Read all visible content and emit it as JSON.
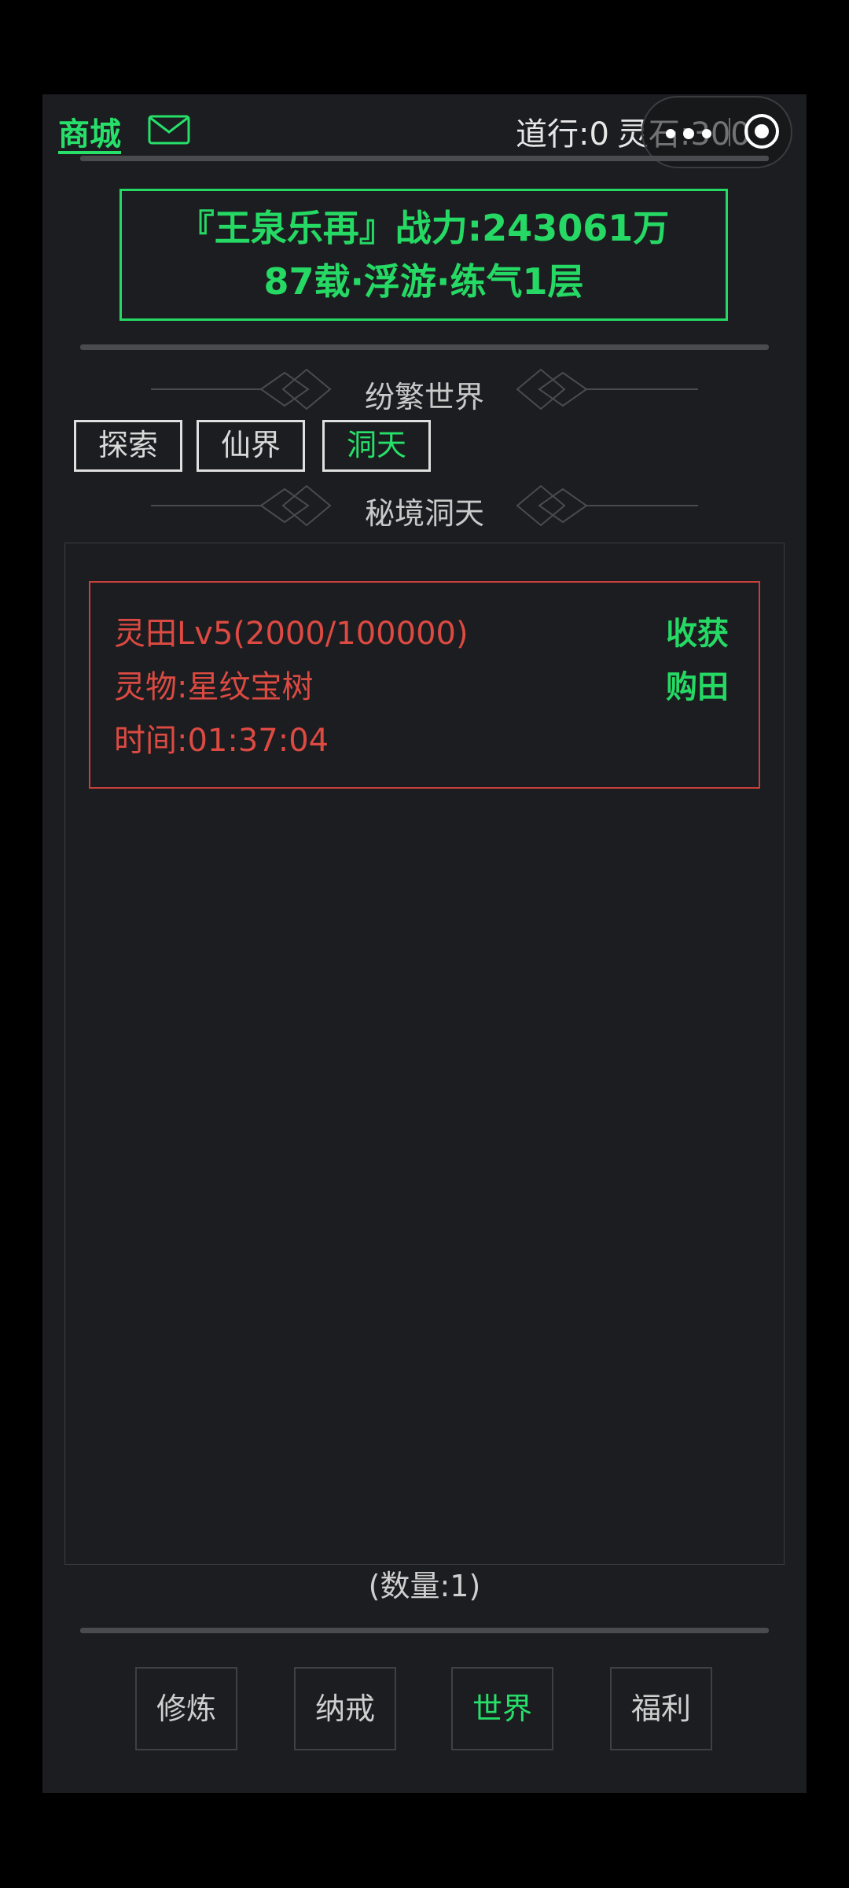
{
  "header": {
    "shop_label": "商城",
    "daoxing_label": "道行:0",
    "lingshi_label": "灵石:300"
  },
  "profile": {
    "line1": "『王泉乐再』战力:243061万",
    "line2": "87载·浮游·练气1层"
  },
  "sections": {
    "world_title": "纷繁世界",
    "realm_title": "秘境洞天"
  },
  "tabs": [
    {
      "label": "探索"
    },
    {
      "label": "仙界"
    },
    {
      "label": "洞天",
      "active": true
    }
  ],
  "field": {
    "level_text": "灵田Lv5(2000/100000)",
    "item_text": "灵物:星纹宝树",
    "time_text": "时间:01:37:04",
    "harvest_label": "收获",
    "buy_label": "购田"
  },
  "count_text": "(数量:1)",
  "nav": [
    {
      "label": "修炼"
    },
    {
      "label": "纳戒"
    },
    {
      "label": "世界",
      "active": true
    },
    {
      "label": "福利"
    }
  ],
  "colors": {
    "accent_green": "#26e06a",
    "field_red": "#dc4a42",
    "background": "#1c1d20"
  },
  "icons": [
    "mail-icon",
    "more-dots-icon",
    "close-target-icon",
    "diamond-ornament-icon"
  ]
}
